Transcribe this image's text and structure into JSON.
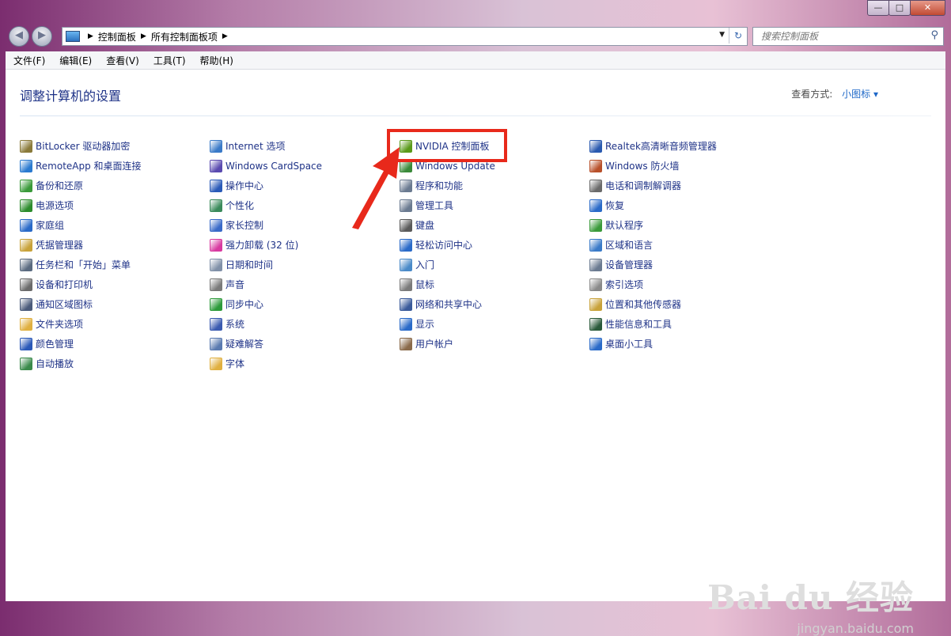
{
  "window": {
    "min_label": "—",
    "max_label": "□",
    "close_label": "✕"
  },
  "nav": {
    "back_label": "◀",
    "forward_label": "▶",
    "breadcrumb": [
      "控制面板",
      "所有控制面板项"
    ],
    "refresh_label": "↻",
    "search_placeholder": "搜索控制面板"
  },
  "menu": [
    "文件(F)",
    "编辑(E)",
    "查看(V)",
    "工具(T)",
    "帮助(H)"
  ],
  "content": {
    "heading": "调整计算机的设置",
    "view_by_label": "查看方式:",
    "view_by_value": "小图标 ▾"
  },
  "columns": [
    [
      {
        "label": "BitLocker 驱动器加密",
        "icon": "bitlocker-icon",
        "color": "#8a7a3a"
      },
      {
        "label": "RemoteApp 和桌面连接",
        "icon": "remoteapp-icon",
        "color": "#2a7ad0"
      },
      {
        "label": "备份和还原",
        "icon": "backup-icon",
        "color": "#3a9a3a"
      },
      {
        "label": "电源选项",
        "icon": "power-icon",
        "color": "#2c8c2c"
      },
      {
        "label": "家庭组",
        "icon": "homegroup-icon",
        "color": "#2a6ac8"
      },
      {
        "label": "凭据管理器",
        "icon": "credential-icon",
        "color": "#c8a23a"
      },
      {
        "label": "任务栏和「开始」菜单",
        "icon": "taskbar-icon",
        "color": "#5a6a80"
      },
      {
        "label": "设备和打印机",
        "icon": "printer-icon",
        "color": "#6a6a6a"
      },
      {
        "label": "通知区域图标",
        "icon": "notification-icon",
        "color": "#4a5a7a"
      },
      {
        "label": "文件夹选项",
        "icon": "folder-icon",
        "color": "#e0b040"
      },
      {
        "label": "颜色管理",
        "icon": "color-icon",
        "color": "#2a58b8"
      },
      {
        "label": "自动播放",
        "icon": "autoplay-icon",
        "color": "#3a8a4a"
      }
    ],
    [
      {
        "label": "Internet 选项",
        "icon": "internet-icon",
        "color": "#3a7ac8"
      },
      {
        "label": "Windows CardSpace",
        "icon": "cardspace-icon",
        "color": "#5a4ab0"
      },
      {
        "label": "操作中心",
        "icon": "flag-icon",
        "color": "#2a5ab8"
      },
      {
        "label": "个性化",
        "icon": "personalize-icon",
        "color": "#3a8a5a"
      },
      {
        "label": "家长控制",
        "icon": "parental-icon",
        "color": "#3a6ac8"
      },
      {
        "label": "强力卸载 (32 位)",
        "icon": "uninstall-icon",
        "color": "#d83aa0"
      },
      {
        "label": "日期和时间",
        "icon": "clock-icon",
        "color": "#8090a8"
      },
      {
        "label": "声音",
        "icon": "speaker-icon",
        "color": "#7a7a7a"
      },
      {
        "label": "同步中心",
        "icon": "sync-icon",
        "color": "#2c9a3a"
      },
      {
        "label": "系统",
        "icon": "system-icon",
        "color": "#3a5ab0"
      },
      {
        "label": "疑难解答",
        "icon": "troubleshoot-icon",
        "color": "#5a7ab0"
      },
      {
        "label": "字体",
        "icon": "fonts-icon",
        "color": "#e0b040"
      }
    ],
    [
      {
        "label": "NVIDIA 控制面板",
        "icon": "nvidia-icon",
        "color": "#5a9a1a"
      },
      {
        "label": "Windows Update",
        "icon": "update-icon",
        "color": "#3a8a3a"
      },
      {
        "label": "程序和功能",
        "icon": "programs-icon",
        "color": "#6a7a90"
      },
      {
        "label": "管理工具",
        "icon": "admin-tools-icon",
        "color": "#6a7a90"
      },
      {
        "label": "键盘",
        "icon": "keyboard-icon",
        "color": "#5a5a5a"
      },
      {
        "label": "轻松访问中心",
        "icon": "accessibility-icon",
        "color": "#2a6ac8"
      },
      {
        "label": "入门",
        "icon": "getting-started-icon",
        "color": "#4a8ac8"
      },
      {
        "label": "鼠标",
        "icon": "mouse-icon",
        "color": "#7a7a7a"
      },
      {
        "label": "网络和共享中心",
        "icon": "network-icon",
        "color": "#3a5a9a"
      },
      {
        "label": "显示",
        "icon": "display-icon",
        "color": "#2a6ac8"
      },
      {
        "label": "用户帐户",
        "icon": "users-icon",
        "color": "#8a6a4a"
      }
    ],
    [
      {
        "label": "Realtek高清晰音频管理器",
        "icon": "realtek-icon",
        "color": "#2a5ab0"
      },
      {
        "label": "Windows 防火墙",
        "icon": "firewall-icon",
        "color": "#b8502a"
      },
      {
        "label": "电话和调制解调器",
        "icon": "phone-icon",
        "color": "#6a6a6a"
      },
      {
        "label": "恢复",
        "icon": "recovery-icon",
        "color": "#2a6ac8"
      },
      {
        "label": "默认程序",
        "icon": "default-programs-icon",
        "color": "#3a9a3a"
      },
      {
        "label": "区域和语言",
        "icon": "region-icon",
        "color": "#3a7ac8"
      },
      {
        "label": "设备管理器",
        "icon": "device-manager-icon",
        "color": "#6a7a90"
      },
      {
        "label": "索引选项",
        "icon": "index-icon",
        "color": "#8a8a8a"
      },
      {
        "label": "位置和其他传感器",
        "icon": "location-icon",
        "color": "#c8a23a"
      },
      {
        "label": "性能信息和工具",
        "icon": "performance-icon",
        "color": "#2a5a3a"
      },
      {
        "label": "桌面小工具",
        "icon": "gadgets-icon",
        "color": "#2a6ac8"
      }
    ]
  ],
  "watermark": {
    "brand": "Bai du 经验",
    "url": "jingyan.baidu.com"
  }
}
